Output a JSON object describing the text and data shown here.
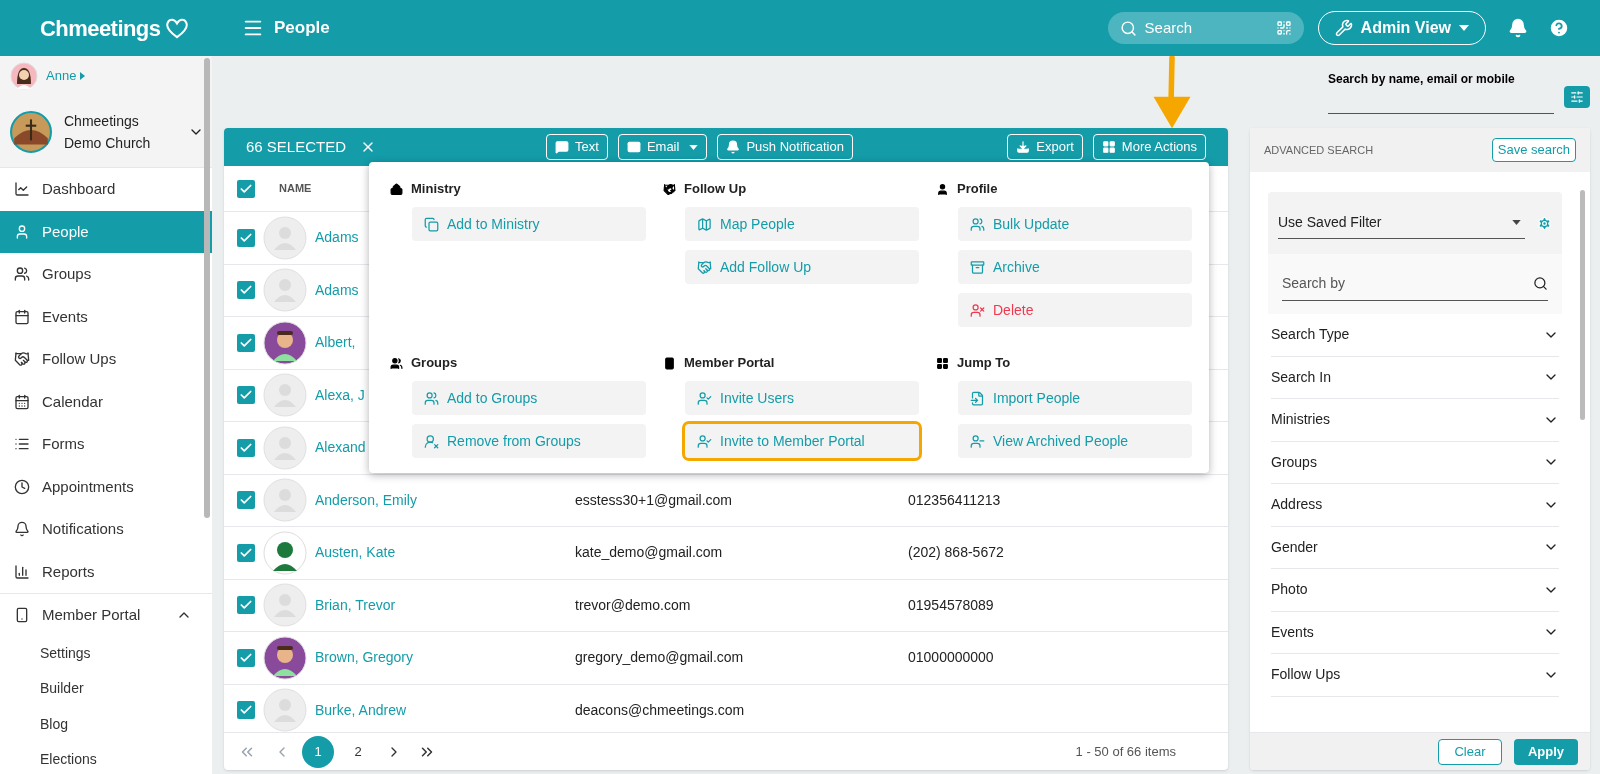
{
  "header": {
    "logo": "Chmeetings",
    "page_title": "People",
    "search_placeholder": "Search",
    "admin_button": "Admin View"
  },
  "sidebar": {
    "user": "Anne",
    "church": "Chmeetings Demo Church",
    "items": [
      {
        "label": "Dashboard",
        "selected": false
      },
      {
        "label": "People",
        "selected": true
      },
      {
        "label": "Groups",
        "selected": false
      },
      {
        "label": "Events",
        "selected": false
      },
      {
        "label": "Follow Ups",
        "selected": false
      },
      {
        "label": "Calendar",
        "selected": false
      },
      {
        "label": "Forms",
        "selected": false
      },
      {
        "label": "Appointments",
        "selected": false
      },
      {
        "label": "Notifications",
        "selected": false
      },
      {
        "label": "Reports",
        "selected": false
      },
      {
        "label": "Member Portal",
        "selected": false,
        "expanded": true,
        "children": [
          {
            "label": "Settings"
          },
          {
            "label": "Builder"
          },
          {
            "label": "Blog"
          },
          {
            "label": "Elections"
          }
        ]
      }
    ]
  },
  "table": {
    "selected_count": "66 SELECTED",
    "actions": [
      {
        "label": "Text",
        "caret": false
      },
      {
        "label": "Email",
        "caret": true
      },
      {
        "label": "Push Notification",
        "caret": false
      }
    ],
    "right_actions": [
      {
        "label": "Export"
      },
      {
        "label": "More Actions"
      }
    ],
    "header_checked": true,
    "columns": [
      {
        "label": "NAME"
      }
    ],
    "rows": [
      {
        "name": "Adams",
        "kind": "placeholder",
        "checked": true
      },
      {
        "name": "Adams",
        "kind": "placeholder",
        "checked": true
      },
      {
        "name": "Albert,",
        "kind": "picture",
        "checked": true
      },
      {
        "name": "Alexa, J",
        "kind": "placeholder",
        "checked": true
      },
      {
        "name": "Alexand",
        "kind": "placeholder",
        "checked": true
      },
      {
        "name": "Anderson, Emily",
        "kind": "placeholder",
        "checked": true,
        "column_2": "esstess30+1@gmail.com",
        "column_3": "012356411213"
      },
      {
        "name": "Austen, Kate",
        "kind": "picture",
        "checked": true,
        "column_2": "kate_demo@gmail.com",
        "column_3": "(202) 868-5672"
      },
      {
        "name": "Brian, Trevor",
        "kind": "placeholder",
        "checked": true,
        "column_2": "trevor@demo.com",
        "column_3": "01954578089"
      },
      {
        "name": "Brown, Gregory",
        "kind": "picture",
        "checked": true,
        "column_2": "gregory_demo@gmail.com",
        "column_3": "01000000000"
      },
      {
        "name": "Burke, Andrew",
        "kind": "placeholder",
        "checked": true,
        "column_2": "deacons@chmeetings.com"
      }
    ],
    "pagination": {
      "pages": [
        {
          "label": "1",
          "selected": true
        },
        {
          "label": "2",
          "selected": false
        }
      ],
      "summary": "1 - 50 of 66 items"
    }
  },
  "more_actions_menu": {
    "sections": [
      {
        "title": "Ministry",
        "items": [
          {
            "label": "Add to Ministry",
            "danger": false,
            "highlighted": false
          }
        ]
      },
      {
        "title": "Follow Up",
        "items": [
          {
            "label": "Map People",
            "danger": false,
            "highlighted": false
          },
          {
            "label": "Add Follow Up",
            "danger": false,
            "highlighted": false
          }
        ]
      },
      {
        "title": "Profile",
        "items": [
          {
            "label": "Bulk Update",
            "danger": false,
            "highlighted": false
          },
          {
            "label": "Archive",
            "danger": false,
            "highlighted": false
          },
          {
            "label": "Delete",
            "danger": true,
            "highlighted": false
          }
        ]
      },
      {
        "title": "Groups",
        "items": [
          {
            "label": "Add to Groups",
            "danger": false,
            "highlighted": false
          },
          {
            "label": "Remove from Groups",
            "danger": false,
            "highlighted": false
          }
        ]
      },
      {
        "title": "Member Portal",
        "items": [
          {
            "label": "Invite Users",
            "danger": false,
            "highlighted": false
          },
          {
            "label": "Invite to Member Portal",
            "danger": false,
            "highlighted": true
          }
        ]
      },
      {
        "title": "Jump To",
        "items": [
          {
            "label": "Import People",
            "danger": false,
            "highlighted": false
          },
          {
            "label": "View Archived People",
            "danger": false,
            "highlighted": false
          }
        ]
      }
    ]
  },
  "quick_search": {
    "label": "Search by name, email or mobile"
  },
  "advanced_search": {
    "title": "ADVANCED SEARCH",
    "save_button": "Save search",
    "saved_filter": "Use Saved Filter",
    "search_placeholder": "Search by",
    "filters": [
      {
        "label": "Search Type"
      },
      {
        "label": "Search In"
      },
      {
        "label": "Ministries"
      },
      {
        "label": "Groups"
      },
      {
        "label": "Address"
      },
      {
        "label": "Gender"
      },
      {
        "label": "Photo"
      },
      {
        "label": "Events"
      },
      {
        "label": "Follow Ups"
      }
    ],
    "clear_button": "Clear",
    "apply_button": "Apply"
  }
}
